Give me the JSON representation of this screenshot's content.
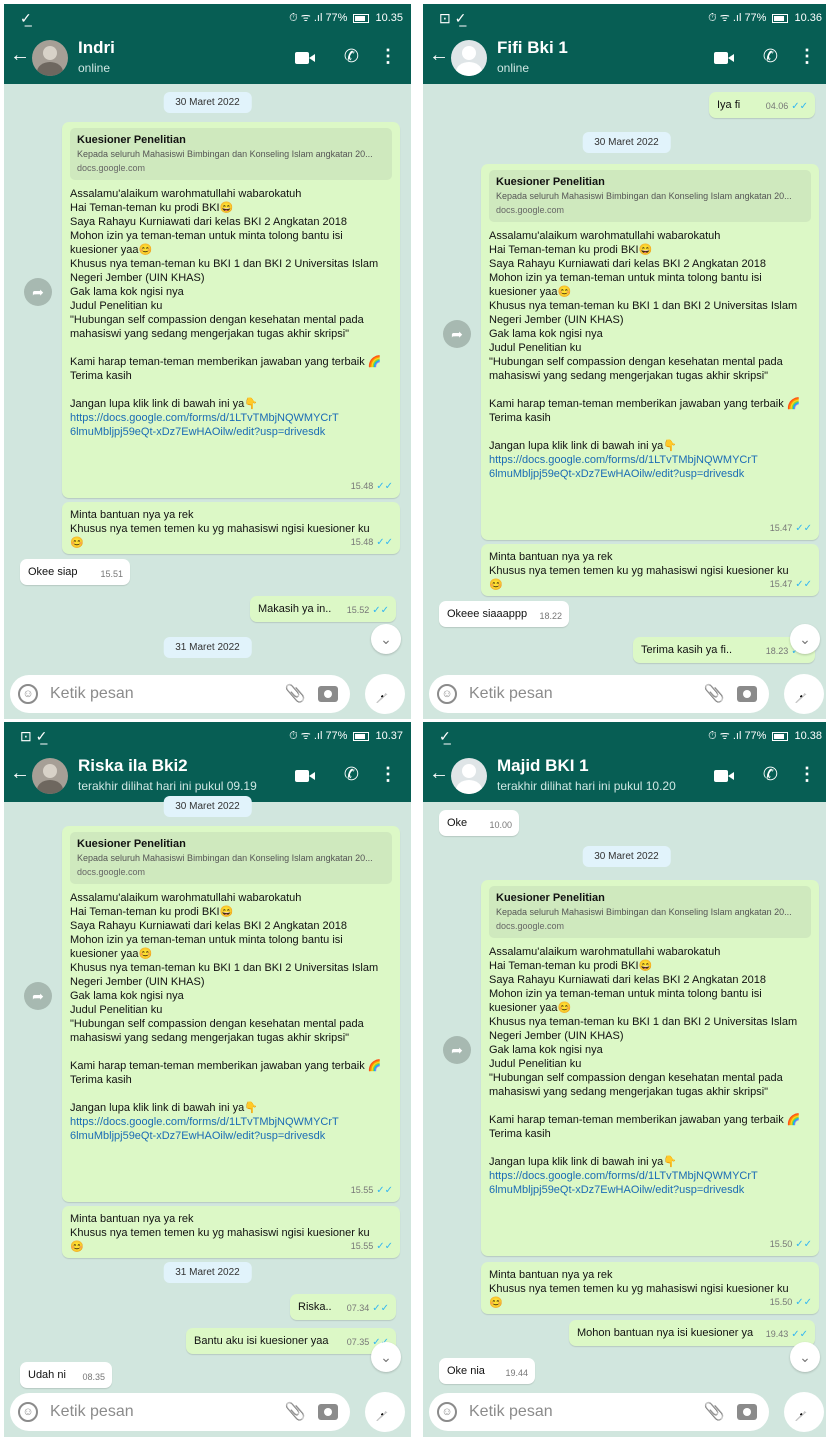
{
  "panels": [
    {
      "status": {
        "left": "✓̲",
        "right": "⏱ ᯤ .ıl 77%",
        "time": "10.35"
      },
      "contact": {
        "name": "Indri",
        "sub": "online"
      },
      "messages": [
        {
          "type": "date",
          "text": "30 Maret 2022"
        },
        {
          "type": "kuesioner",
          "time": "15.48"
        },
        {
          "type": "out",
          "text": "Minta bantuan nya ya rek\nKhusus nya temen temen ku yg mahasiswi ngisi kuesioner ku\n😊",
          "time": "15.48"
        },
        {
          "type": "in",
          "text": "Okee siap",
          "time": "15.51"
        },
        {
          "type": "out",
          "text": "Makasih ya in..",
          "time": "15.52"
        },
        {
          "type": "date",
          "text": "31 Maret 2022"
        }
      ],
      "input_placeholder": "Ketik pesan"
    },
    {
      "status": {
        "left": "⊡ ✓̲",
        "right": "⏱ ᯤ .ıl 77%",
        "time": "10.36"
      },
      "contact": {
        "name": "Fifi Bki 1",
        "sub": "online"
      },
      "messages": [
        {
          "type": "out",
          "text": "Iya fi",
          "time": "04.06"
        },
        {
          "type": "date",
          "text": "30 Maret 2022"
        },
        {
          "type": "kuesioner",
          "time": "15.47"
        },
        {
          "type": "out",
          "text": "Minta bantuan nya ya rek\nKhusus nya temen temen ku yg mahasiswi ngisi kuesioner ku\n😊",
          "time": "15.47"
        },
        {
          "type": "in",
          "text": "Okeee siaaappp",
          "time": "18.22"
        },
        {
          "type": "out",
          "text": "Terima kasih ya fi..",
          "time": "18.23"
        }
      ],
      "input_placeholder": "Ketik pesan"
    },
    {
      "status": {
        "left": "⊡ ✓̲",
        "right": "⏱ ᯤ .ıl 77%",
        "time": "10.37"
      },
      "contact": {
        "name": "Riska ila Bki2",
        "sub": "terakhir dilihat hari ini pukul 09.19"
      },
      "messages": [
        {
          "type": "date",
          "text": "30 Maret 2022"
        },
        {
          "type": "kuesioner",
          "time": "15.55"
        },
        {
          "type": "out",
          "text": "Minta bantuan nya ya rek\nKhusus nya temen temen ku yg mahasiswi ngisi kuesioner ku\n😊",
          "time": "15.55"
        },
        {
          "type": "date",
          "text": "31 Maret 2022"
        },
        {
          "type": "out",
          "text": "Riska..",
          "time": "07.34"
        },
        {
          "type": "out",
          "text": "Bantu aku isi kuesioner yaa",
          "time": "07.35"
        },
        {
          "type": "in",
          "text": "Udah ni",
          "time": "08.35"
        }
      ],
      "input_placeholder": "Ketik pesan"
    },
    {
      "status": {
        "left": "✓̲",
        "right": "⏱ ᯤ .ıl 77%",
        "time": "10.38"
      },
      "contact": {
        "name": "Majid BKI 1",
        "sub": "terakhir dilihat hari ini pukul 10.20"
      },
      "messages": [
        {
          "type": "in",
          "text": "Oke",
          "time": "10.00"
        },
        {
          "type": "date",
          "text": "30 Maret 2022"
        },
        {
          "type": "kuesioner",
          "time": "15.50"
        },
        {
          "type": "out",
          "text": "Minta bantuan nya ya rek\nKhusus nya temen temen ku yg mahasiswi ngisi kuesioner ku\n😊",
          "time": "15.50"
        },
        {
          "type": "out",
          "text": "Mohon bantuan nya isi kuesioner ya",
          "time": "19.43"
        },
        {
          "type": "in",
          "text": "Oke nia",
          "time": "19.44"
        }
      ],
      "input_placeholder": "Ketik pesan"
    }
  ],
  "kuesioner": {
    "preview_title": "Kuesioner Penelitian",
    "preview_desc": "Kepada seluruh Mahasiswi Bimbingan dan Konseling Islam angkatan 20...",
    "preview_url": "docs.google.com",
    "body": "Assalamu'alaikum warohmatullahi wabarokatuh\nHai Teman-teman ku prodi BKI😄\nSaya Rahayu Kurniawati dari kelas BKI 2 Angkatan 2018\nMohon izin ya teman-teman untuk minta tolong bantu isi kuesioner yaa😊\nKhusus nya teman-teman ku BKI 1 dan BKI 2 Universitas Islam Negeri Jember (UIN KHAS)\nGak lama kok ngisi nya\nJudul Penelitian ku\n\"Hubungan self compassion dengan kesehatan mental pada mahasiswi yang sedang mengerjakan tugas akhir skripsi\"\n\nKami harap teman-teman memberikan jawaban yang terbaik 🌈\nTerima kasih\n\nJangan lupa klik link di bawah ini ya👇",
    "link": "https://docs.google.com/forms/d/1LTvTMbjNQWMYCrT6lmuMbljpj59eQt-xDz7EwHAOilw/edit?usp=drivesdk"
  },
  "icons": {
    "back": "back-arrow-icon",
    "video": "video-call-icon",
    "phone": "phone-icon",
    "menu": "more-vert-icon",
    "emoji": "emoji-icon",
    "attach": "attach-icon",
    "camera": "camera-icon",
    "mic": "mic-icon",
    "forward": "forward-icon",
    "scroll": "scroll-down-icon"
  }
}
